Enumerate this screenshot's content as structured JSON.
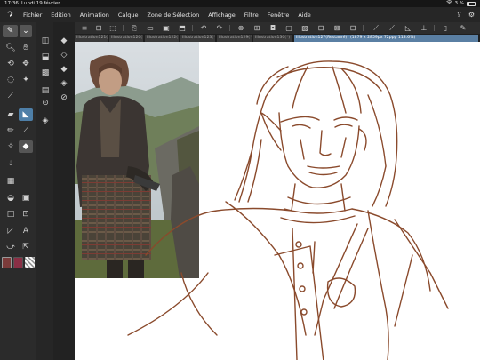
{
  "status_bar": {
    "time": "17:36",
    "date": "Lundi 19 février",
    "battery_text": "3 %"
  },
  "menu": {
    "items": [
      "Fichier",
      "Édition",
      "Animation",
      "Calque",
      "Zone de Sélection",
      "Affichage",
      "Filtre",
      "Fenêtre",
      "Aide"
    ]
  },
  "tabs": [
    {
      "label": "Illustration121(*)",
      "active": false
    },
    {
      "label": "Illustration120(*)",
      "active": false
    },
    {
      "label": "Illustration122(*)",
      "active": false
    },
    {
      "label": "Illustration123(*)",
      "active": false
    },
    {
      "label": "Illustration129(*)",
      "active": false
    },
    {
      "label": "Illustration130(*)",
      "active": false
    },
    {
      "label": "Illustration127(Restauré)* (1879 x 2859px 72ppp 113.6%)",
      "active": true
    }
  ],
  "colors": {
    "main_color": "#7b3b3a",
    "sub_color": "#8a2f45",
    "sketch_stroke": "#8a4a2c",
    "active_tool": "#4e7fa8",
    "active_tab": "#5a7fa3"
  },
  "icons": {
    "app": "clip-studio-icon",
    "wifi": "wifi-icon",
    "battery": "battery-icon",
    "tools": [
      "pen-icon",
      "eyedropper-icon",
      "move-icon",
      "hand-icon",
      "lasso-icon",
      "magic-wand-icon",
      "pen-nib-icon",
      "gradient-icon",
      "fill-icon",
      "eraser-icon",
      "blend-icon",
      "star-icon",
      "grid-icon",
      "fill-bucket-icon",
      "rectangle-icon",
      "text-icon",
      "ruler-icon",
      "selection-icon"
    ]
  }
}
